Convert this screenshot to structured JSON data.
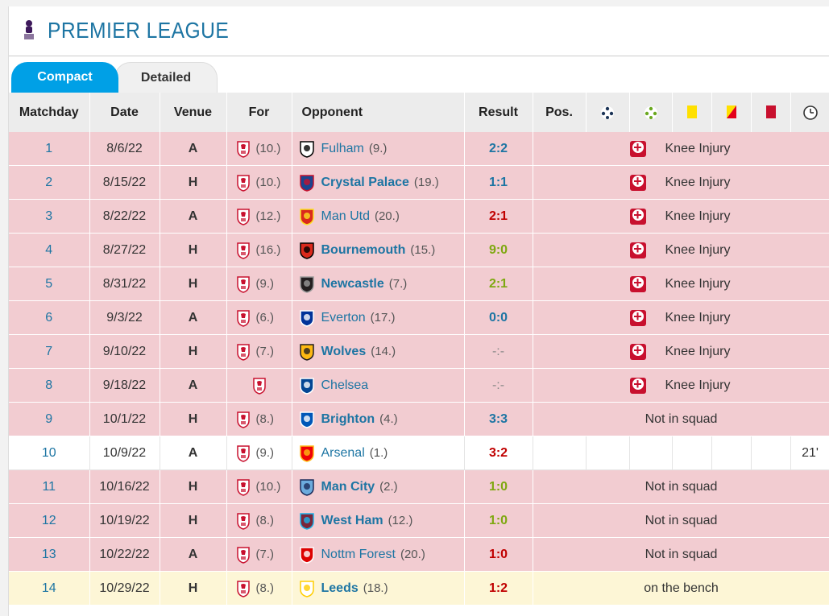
{
  "league": {
    "title": "PREMIER LEAGUE"
  },
  "tabs": [
    {
      "label": "Compact",
      "active": true
    },
    {
      "label": "Detailed",
      "active": false
    }
  ],
  "columns": {
    "matchday": "Matchday",
    "date": "Date",
    "venue": "Venue",
    "for": "For",
    "opponent": "Opponent",
    "result": "Result",
    "pos": "Pos.",
    "goals_icon": "ball-icon",
    "assists_icon": "assist-ball-icon",
    "yellow_icon": "yellow-card-icon",
    "yellowred_icon": "yellow-red-card-icon",
    "red_icon": "red-card-icon",
    "minutes_icon": "clock-icon"
  },
  "rows": [
    {
      "md": "1",
      "date": "8/6/22",
      "venue": "A",
      "for_rank": "(10.)",
      "opponent": "Fulham",
      "opp_rank": "(9.)",
      "opp_bold": false,
      "result": "2:2",
      "result_color": "blue",
      "status": "Knee Injury",
      "type": "injured",
      "crest_color": "#ffffff",
      "crest_stroke": "#000000"
    },
    {
      "md": "2",
      "date": "8/15/22",
      "venue": "H",
      "for_rank": "(10.)",
      "opponent": "Crystal Palace",
      "opp_rank": "(19.)",
      "opp_bold": true,
      "result": "1:1",
      "result_color": "blue",
      "status": "Knee Injury",
      "type": "injured",
      "crest_color": "#1b458f",
      "crest_stroke": "#c4122e"
    },
    {
      "md": "3",
      "date": "8/22/22",
      "venue": "A",
      "for_rank": "(12.)",
      "opponent": "Man Utd",
      "opp_rank": "(20.)",
      "opp_bold": false,
      "result": "2:1",
      "result_color": "red",
      "status": "Knee Injury",
      "type": "injured",
      "crest_color": "#da291c",
      "crest_stroke": "#fbe122"
    },
    {
      "md": "4",
      "date": "8/27/22",
      "venue": "H",
      "for_rank": "(16.)",
      "opponent": "Bournemouth",
      "opp_rank": "(15.)",
      "opp_bold": true,
      "result": "9:0",
      "result_color": "green",
      "status": "Knee Injury",
      "type": "injured",
      "crest_color": "#da291c",
      "crest_stroke": "#000000"
    },
    {
      "md": "5",
      "date": "8/31/22",
      "venue": "H",
      "for_rank": "(9.)",
      "opponent": "Newcastle",
      "opp_rank": "(7.)",
      "opp_bold": true,
      "result": "2:1",
      "result_color": "green",
      "status": "Knee Injury",
      "type": "injured",
      "crest_color": "#241f20",
      "crest_stroke": "#999999"
    },
    {
      "md": "6",
      "date": "9/3/22",
      "venue": "A",
      "for_rank": "(6.)",
      "opponent": "Everton",
      "opp_rank": "(17.)",
      "opp_bold": false,
      "result": "0:0",
      "result_color": "blue",
      "status": "Knee Injury",
      "type": "injured",
      "crest_color": "#003399",
      "crest_stroke": "#ffffff"
    },
    {
      "md": "7",
      "date": "9/10/22",
      "venue": "H",
      "for_rank": "(7.)",
      "opponent": "Wolves",
      "opp_rank": "(14.)",
      "opp_bold": true,
      "result": "-:-",
      "result_color": "none",
      "status": "Knee Injury",
      "type": "injured",
      "crest_color": "#fdb913",
      "crest_stroke": "#231f20"
    },
    {
      "md": "8",
      "date": "9/18/22",
      "venue": "A",
      "for_rank": "",
      "opponent": "Chelsea",
      "opp_rank": "",
      "opp_bold": false,
      "result": "-:-",
      "result_color": "none",
      "status": "Knee Injury",
      "type": "injured",
      "crest_color": "#034694",
      "crest_stroke": "#ffffff"
    },
    {
      "md": "9",
      "date": "10/1/22",
      "venue": "H",
      "for_rank": "(8.)",
      "opponent": "Brighton",
      "opp_rank": "(4.)",
      "opp_bold": true,
      "result": "3:3",
      "result_color": "blue",
      "status": "Not in squad",
      "type": "injured",
      "crest_color": "#0057b8",
      "crest_stroke": "#ffffff"
    },
    {
      "md": "10",
      "date": "10/9/22",
      "venue": "A",
      "for_rank": "(9.)",
      "opponent": "Arsenal",
      "opp_rank": "(1.)",
      "opp_bold": false,
      "result": "3:2",
      "result_color": "red",
      "status": "",
      "minutes": "21'",
      "type": "played",
      "crest_color": "#ef0107",
      "crest_stroke": "#fdb913"
    },
    {
      "md": "11",
      "date": "10/16/22",
      "venue": "H",
      "for_rank": "(10.)",
      "opponent": "Man City",
      "opp_rank": "(2.)",
      "opp_bold": true,
      "result": "1:0",
      "result_color": "green",
      "status": "Not in squad",
      "type": "injured",
      "crest_color": "#6cabdd",
      "crest_stroke": "#1c2c5b"
    },
    {
      "md": "12",
      "date": "10/19/22",
      "venue": "H",
      "for_rank": "(8.)",
      "opponent": "West Ham",
      "opp_rank": "(12.)",
      "opp_bold": true,
      "result": "1:0",
      "result_color": "green",
      "status": "Not in squad",
      "type": "injured",
      "crest_color": "#7a263a",
      "crest_stroke": "#1bb1e7"
    },
    {
      "md": "13",
      "date": "10/22/22",
      "venue": "A",
      "for_rank": "(7.)",
      "opponent": "Nottm Forest",
      "opp_rank": "(20.)",
      "opp_bold": false,
      "result": "1:0",
      "result_color": "red",
      "status": "Not in squad",
      "type": "injured",
      "crest_color": "#dd0000",
      "crest_stroke": "#ffffff"
    },
    {
      "md": "14",
      "date": "10/29/22",
      "venue": "H",
      "for_rank": "(8.)",
      "opponent": "Leeds",
      "opp_rank": "(18.)",
      "opp_bold": true,
      "result": "1:2",
      "result_color": "red",
      "status": "on the bench",
      "type": "bench",
      "crest_color": "#ffffff",
      "crest_stroke": "#ffcd00"
    }
  ]
}
